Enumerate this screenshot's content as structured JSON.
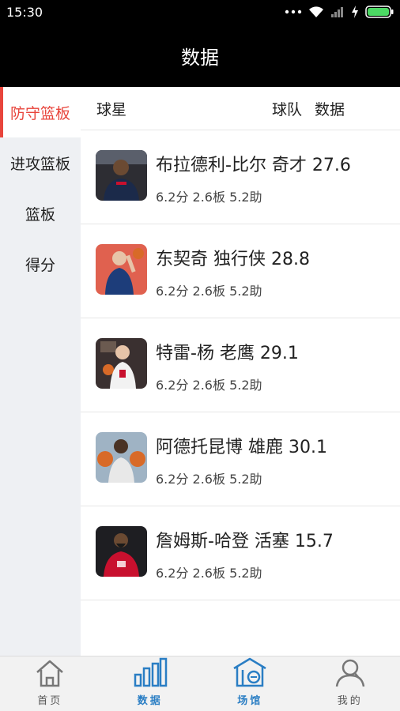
{
  "status_bar": {
    "time": "15:30"
  },
  "header": {
    "title": "数据"
  },
  "sidebar": {
    "items": [
      {
        "label": "防守篮板"
      },
      {
        "label": "进攻篮板"
      },
      {
        "label": "篮板"
      },
      {
        "label": "得分"
      }
    ],
    "active_index": 0
  },
  "list_header": {
    "player": "球星",
    "team": "球队",
    "data": "数据"
  },
  "players": [
    {
      "title": "布拉德利-比尔 奇才 27.6",
      "stats": "6.2分 2.6板 5.2助",
      "avatar_icon": "player-avatar-icon",
      "jersey_color": "#1b2a4a"
    },
    {
      "title": "东契奇 独行侠 28.8",
      "stats": "6.2分 2.6板 5.2助",
      "avatar_icon": "player-avatar-icon",
      "jersey_color": "#1d3d7a"
    },
    {
      "title": "特雷-杨 老鹰 29.1",
      "stats": "6.2分 2.6板 5.2助",
      "avatar_icon": "player-avatar-icon",
      "jersey_color": "#f2f2f2"
    },
    {
      "title": "阿德托昆博 雄鹿 30.1",
      "stats": "6.2分 2.6板 5.2助",
      "avatar_icon": "player-avatar-icon",
      "jersey_color": "#e8e8e8"
    },
    {
      "title": "詹姆斯-哈登 活塞 15.7",
      "stats": "6.2分 2.6板 5.2助",
      "avatar_icon": "player-avatar-icon",
      "jersey_color": "#c8102e"
    }
  ],
  "tabs": [
    {
      "label": "首页",
      "icon": "home-icon"
    },
    {
      "label": "数据",
      "icon": "bar-chart-icon"
    },
    {
      "label": "场馆",
      "icon": "venue-icon"
    },
    {
      "label": "我的",
      "icon": "user-icon"
    }
  ],
  "colors": {
    "accent": "#e8453c",
    "tab_selected": "#2a7ec4",
    "sidebar_bg": "#eef0f3"
  }
}
